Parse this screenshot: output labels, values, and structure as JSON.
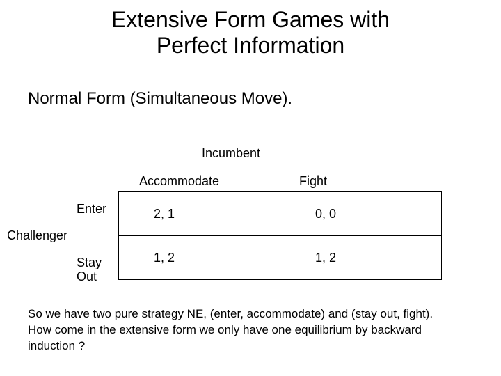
{
  "title_line1": "Extensive Form Games with",
  "title_line2": "Perfect Information",
  "subhead": "Normal Form (Simultaneous Move).",
  "col_player": "Incumbent",
  "row_player": "Challenger",
  "cols": {
    "c1": "Accommodate",
    "c2": "Fight"
  },
  "rows": {
    "r1": "Enter",
    "r2_l1": "Stay",
    "r2_l2": "Out"
  },
  "cells": {
    "r1c1": {
      "p1": "2",
      "sep": ",",
      "p2": "1",
      "u1": true,
      "u2": true
    },
    "r1c2": {
      "p1": "0",
      "sep": ",",
      "p2": "0",
      "u1": false,
      "u2": false
    },
    "r2c1": {
      "p1": "1",
      "sep": ",",
      "p2": "2",
      "u1": false,
      "u2": true
    },
    "r2c2": {
      "p1": "1",
      "sep": ",",
      "p2": "2",
      "u1": true,
      "u2": true
    }
  },
  "footer_l1": "So we have two pure strategy NE, (enter, accommodate) and (stay out, fight).",
  "footer_l2": "How come in the extensive form we only have one equilibrium by backward",
  "footer_l3": "induction ?"
}
